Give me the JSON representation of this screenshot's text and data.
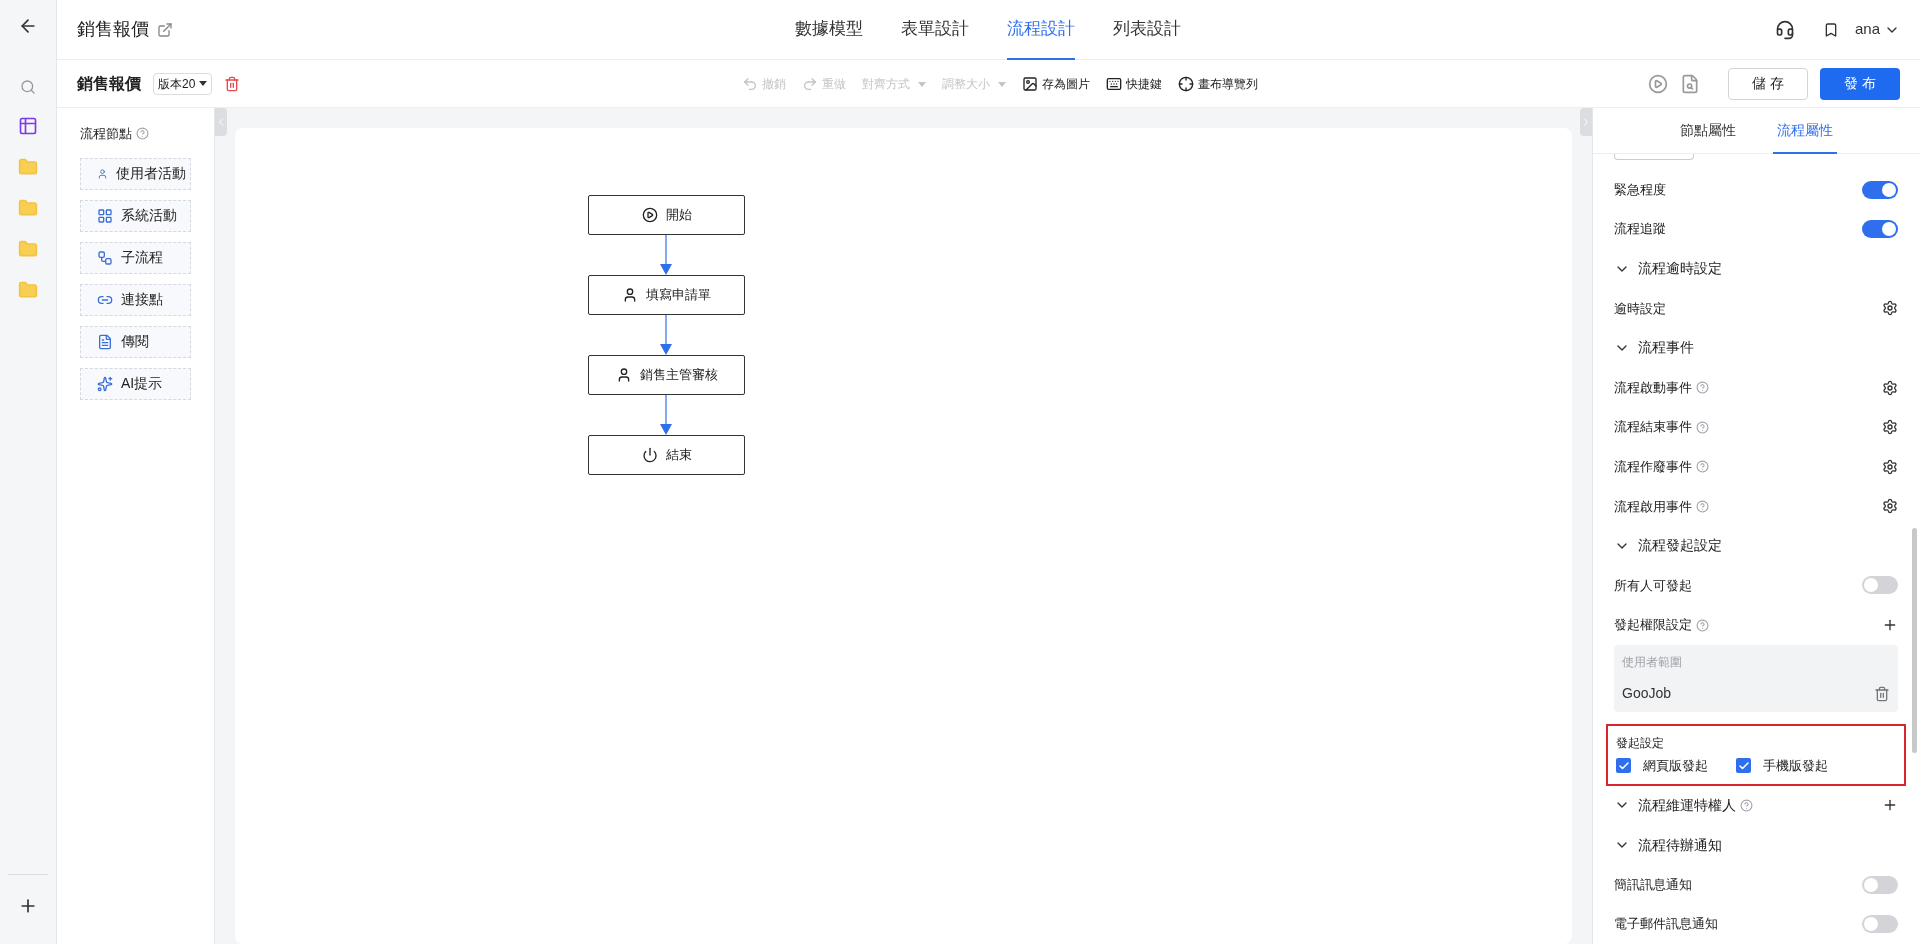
{
  "header": {
    "title": "銷售報價",
    "tabs": [
      {
        "label": "數據模型",
        "selected": false
      },
      {
        "label": "表單設計",
        "selected": false
      },
      {
        "label": "流程設計",
        "selected": true
      },
      {
        "label": "列表設計",
        "selected": false
      }
    ],
    "user": "ana"
  },
  "toolbar": {
    "title": "銷售報價",
    "version": "版本20",
    "actions": [
      {
        "kind": "undo",
        "label": "撤銷",
        "disabled": true
      },
      {
        "kind": "redo",
        "label": "重做",
        "disabled": true
      },
      {
        "kind": "align",
        "label": "對齊方式",
        "disabled": true
      },
      {
        "kind": "resize",
        "label": "調整大小",
        "disabled": true
      },
      {
        "kind": "image",
        "label": "存為圖片",
        "disabled": false
      },
      {
        "kind": "keyboard",
        "label": "快捷鍵",
        "disabled": false
      },
      {
        "kind": "navigator",
        "label": "畫布導覽列",
        "disabled": false
      }
    ],
    "save": "儲 存",
    "publish": "發 布"
  },
  "node_panel": {
    "title": "流程節點",
    "nodes": [
      {
        "kind": "user",
        "label": "使用者活動"
      },
      {
        "kind": "system",
        "label": "系統活動"
      },
      {
        "kind": "subflow",
        "label": "子流程"
      },
      {
        "kind": "link",
        "label": "連接點"
      },
      {
        "kind": "notify",
        "label": "傳閱"
      },
      {
        "kind": "ai",
        "label": "AI提示"
      }
    ]
  },
  "flow": {
    "nodes": [
      {
        "kind": "start",
        "label": "開始"
      },
      {
        "kind": "user",
        "label": "填寫申請單"
      },
      {
        "kind": "user",
        "label": "銷售主管審核"
      },
      {
        "kind": "end",
        "label": "結束"
      }
    ]
  },
  "properties": {
    "tabs": [
      {
        "label": "節點屬性",
        "selected": false
      },
      {
        "label": "流程屬性",
        "selected": true
      }
    ],
    "items": [
      {
        "kind": "toggle",
        "label": "緊急程度",
        "on": true
      },
      {
        "kind": "toggle",
        "label": "流程追蹤",
        "on": true
      },
      {
        "kind": "section",
        "label": "流程逾時設定",
        "expanded": true,
        "help": false,
        "add": false
      },
      {
        "kind": "setting",
        "label": "逾時設定",
        "help": false
      },
      {
        "kind": "section",
        "label": "流程事件",
        "expanded": true,
        "help": false,
        "add": false
      },
      {
        "kind": "setting",
        "label": "流程啟動事件",
        "help": true
      },
      {
        "kind": "setting",
        "label": "流程結束事件",
        "help": true
      },
      {
        "kind": "setting",
        "label": "流程作廢事件",
        "help": true
      },
      {
        "kind": "setting",
        "label": "流程啟用事件",
        "help": true
      },
      {
        "kind": "section",
        "label": "流程發起設定",
        "expanded": true,
        "help": false,
        "add": false
      },
      {
        "kind": "toggle",
        "label": "所有人可發起",
        "on": false
      },
      {
        "kind": "permission",
        "label": "發起權限設定",
        "help": true,
        "scope_label": "使用者範圍",
        "value": "GooJob"
      },
      {
        "kind": "checks",
        "label": "發起設定",
        "highlighted": true,
        "options": [
          {
            "label": "網頁版發起",
            "checked": true
          },
          {
            "label": "手機版發起",
            "checked": true
          }
        ]
      },
      {
        "kind": "section",
        "label": "流程維運特權人",
        "expanded": true,
        "help": true,
        "add": true
      },
      {
        "kind": "section",
        "label": "流程待辦通知",
        "expanded": true,
        "help": false,
        "add": false
      },
      {
        "kind": "toggle",
        "label": "簡訊訊息通知",
        "on": false
      },
      {
        "kind": "toggle",
        "label": "電子郵件訊息通知",
        "on": false
      }
    ]
  }
}
